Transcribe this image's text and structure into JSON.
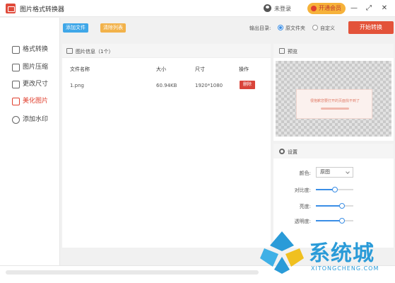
{
  "app": {
    "title": "图片格式转换器",
    "login": "未登录",
    "vip": "开通会员"
  },
  "window": {
    "min": "—",
    "restore": "⤢",
    "close": "✕"
  },
  "sidebar": {
    "items": [
      {
        "label": "格式转换",
        "icon": "format-convert-icon",
        "active": false
      },
      {
        "label": "图片压缩",
        "icon": "compress-icon",
        "active": false
      },
      {
        "label": "更改尺寸",
        "icon": "resize-icon",
        "active": false
      },
      {
        "label": "美化图片",
        "icon": "beautify-icon",
        "active": true
      },
      {
        "label": "添加水印",
        "icon": "watermark-icon",
        "active": false
      }
    ]
  },
  "toolbar": {
    "add_files": "添加文件",
    "clear_list": "清除列表",
    "output_label": "输出目录:",
    "output_options": [
      "原文件夹",
      "自定义"
    ],
    "output_selected": "原文件夹",
    "start": "开始转换"
  },
  "file_panel": {
    "title": "图片信息（1个）",
    "columns": [
      "文件名称",
      "大小",
      "尺寸",
      "操作"
    ],
    "rows": [
      {
        "name": "1.png",
        "size": "60.94KB",
        "dimensions": "1920*1080",
        "action": "删除"
      }
    ]
  },
  "preview": {
    "title": "预览",
    "card_text": "很抱歉您要打开的页面找不到了"
  },
  "settings": {
    "title": "设置",
    "color_label": "颜色:",
    "color_value": "原图",
    "contrast_label": "对比度:",
    "contrast": 0.5,
    "brightness_label": "亮度:",
    "brightness": 0.7,
    "opacity_label": "透明度:",
    "opacity": 0.7
  },
  "watermark": {
    "name": "系统城",
    "url": "XITONGCHENG.COM"
  },
  "colors": {
    "accent": "#e0402f",
    "blue": "#3a8ee6",
    "start": "#e3533a"
  }
}
